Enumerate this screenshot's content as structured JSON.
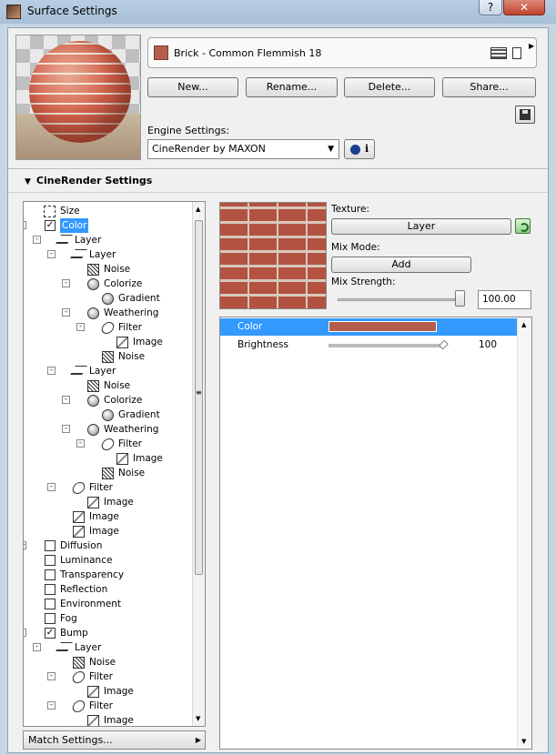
{
  "window": {
    "title": "Surface Settings",
    "help_label": "?",
    "close_label": "✕"
  },
  "material": {
    "name": "Brick - Common Flemmish 18",
    "swatch_color": "#b55d4c"
  },
  "buttons": {
    "new": "New...",
    "rename": "Rename...",
    "delete": "Delete...",
    "share": "Share..."
  },
  "engine": {
    "label": "Engine Settings:",
    "selected": "CineRender by MAXON",
    "info_label": "i"
  },
  "section": {
    "title": "CineRender Settings"
  },
  "tree": [
    {
      "label": "Size",
      "icon": "size-icon"
    },
    {
      "label": "Color",
      "checked": "✓",
      "selected": true
    },
    {
      "label": "Layer",
      "icon": "layer-icon"
    },
    {
      "label": "Layer",
      "icon": "layer-icon"
    },
    {
      "label": "Noise",
      "icon": "noise-icon"
    },
    {
      "label": "Colorize",
      "icon": "sphere-icon"
    },
    {
      "label": "Gradient",
      "icon": "sphere-icon"
    },
    {
      "label": "Weathering",
      "icon": "sphere-icon"
    },
    {
      "label": "Filter",
      "icon": "filter-icon"
    },
    {
      "label": "Image",
      "icon": "image-icon"
    },
    {
      "label": "Noise",
      "icon": "noise-icon"
    },
    {
      "label": "Layer",
      "icon": "layer-icon"
    },
    {
      "label": "Noise",
      "icon": "noise-icon"
    },
    {
      "label": "Colorize",
      "icon": "sphere-icon"
    },
    {
      "label": "Gradient",
      "icon": "sphere-icon"
    },
    {
      "label": "Weathering",
      "icon": "sphere-icon"
    },
    {
      "label": "Filter",
      "icon": "filter-icon"
    },
    {
      "label": "Image",
      "icon": "image-icon"
    },
    {
      "label": "Noise",
      "icon": "noise-icon"
    },
    {
      "label": "Filter",
      "icon": "filter-icon"
    },
    {
      "label": "Image",
      "icon": "image-icon"
    },
    {
      "label": "Image",
      "icon": "image-icon"
    },
    {
      "label": "Image",
      "icon": "image-icon"
    },
    {
      "label": "Diffusion",
      "checked": ""
    },
    {
      "label": "Luminance",
      "checked": ""
    },
    {
      "label": "Transparency",
      "checked": ""
    },
    {
      "label": "Reflection",
      "checked": ""
    },
    {
      "label": "Environment",
      "checked": ""
    },
    {
      "label": "Fog",
      "checked": ""
    },
    {
      "label": "Bump",
      "checked": "✓"
    },
    {
      "label": "Layer",
      "icon": "layer-icon"
    },
    {
      "label": "Noise",
      "icon": "noise-icon"
    },
    {
      "label": "Filter",
      "icon": "filter-icon"
    },
    {
      "label": "Image",
      "icon": "image-icon"
    },
    {
      "label": "Filter",
      "icon": "filter-icon"
    },
    {
      "label": "Image",
      "icon": "image-icon"
    }
  ],
  "match_settings": "Match Settings...",
  "texture": {
    "label": "Texture:",
    "value": "Layer",
    "mix_mode_label": "Mix Mode:",
    "mix_mode_value": "Add",
    "mix_strength_label": "Mix Strength:",
    "mix_strength_value": "100.00",
    "mix_strength_fraction": 1.0
  },
  "params": [
    {
      "name": "Color",
      "value": "",
      "color": "#b55d4c"
    },
    {
      "name": "Brightness",
      "value": "100"
    }
  ]
}
